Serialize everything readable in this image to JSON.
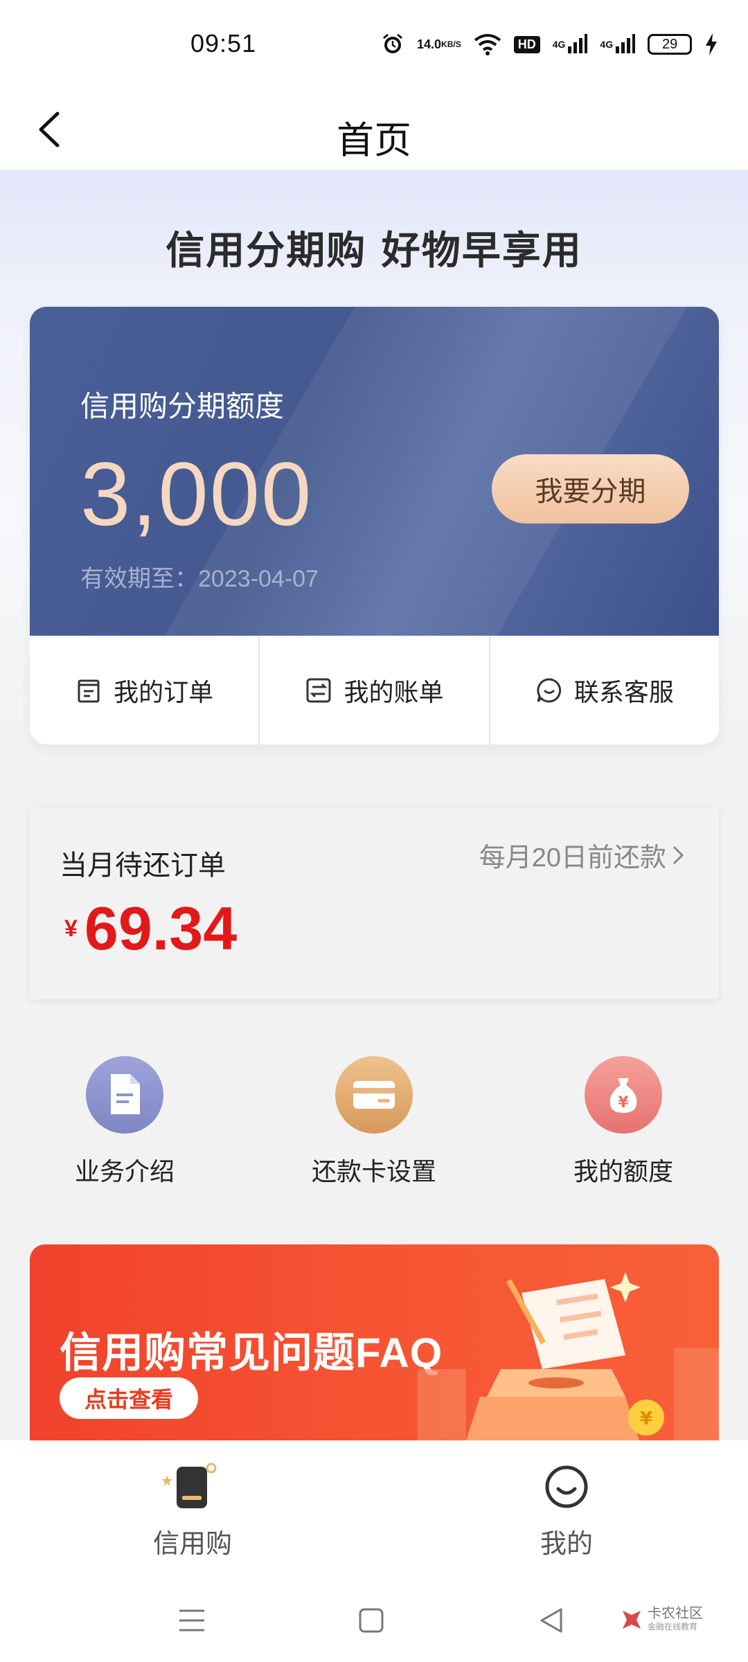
{
  "status_bar": {
    "time": "09:51",
    "net_speed": "14.0",
    "net_speed_unit": "KB/S",
    "hd_label": "HD",
    "network_1": "4G",
    "network_2": "4G",
    "battery": "29",
    "icons": [
      "alarm-icon",
      "wifi-icon",
      "signal-icon",
      "battery-icon",
      "charging-icon"
    ]
  },
  "nav": {
    "title": "首页",
    "back_icon": "chevron-left-icon"
  },
  "hero": {
    "slogan": "信用分期购 好物早享用"
  },
  "credit_card": {
    "label": "信用购分期额度",
    "amount": "3,000",
    "expiry": "有效期至：2023-04-07",
    "install_button": "我要分期",
    "actions": [
      {
        "label": "我的订单",
        "icon": "order-icon"
      },
      {
        "label": "我的账单",
        "icon": "bill-icon"
      },
      {
        "label": "联系客服",
        "icon": "chat-icon"
      }
    ]
  },
  "repay": {
    "title": "当月待还订单",
    "due_text": "每月20日前还款",
    "currency": "¥",
    "amount": "69.34"
  },
  "quick_links": [
    {
      "label": "业务介绍",
      "icon": "document-icon",
      "color": "#8d93cf"
    },
    {
      "label": "还款卡设置",
      "icon": "card-icon",
      "color": "#e3a96b"
    },
    {
      "label": "我的额度",
      "icon": "money-bag-icon",
      "color": "#ef8a86"
    }
  ],
  "banner": {
    "title": "信用购常见问题FAQ",
    "button": "点击查看"
  },
  "tabbar": {
    "tabs": [
      {
        "label": "信用购",
        "icon": "credit-phone-icon"
      },
      {
        "label": "我的",
        "icon": "smile-icon"
      }
    ]
  },
  "system_nav": {
    "watermark_main": "卡农社区",
    "watermark_sub": "金融在线教育"
  },
  "colors": {
    "card_blue": "#43598f",
    "accent_peach": "#f0c29f",
    "amount_red": "#e1191a",
    "banner_red": "#f0422c"
  }
}
